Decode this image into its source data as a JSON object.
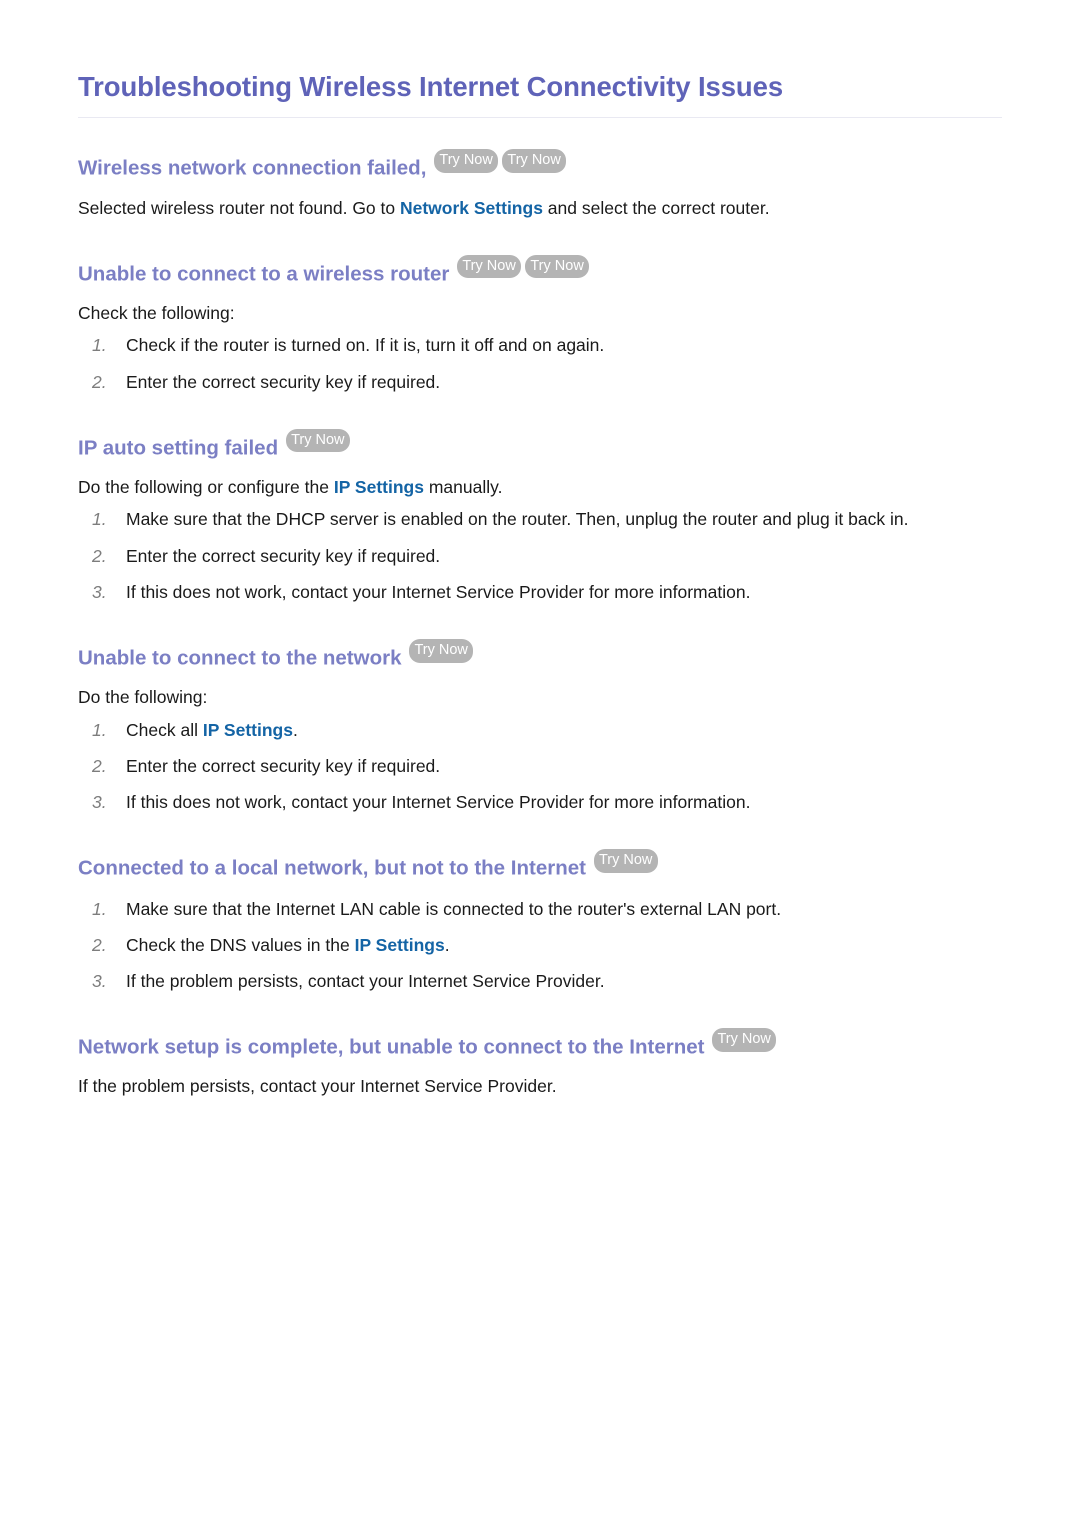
{
  "page": {
    "title": "Troubleshooting Wireless Internet Connectivity Issues"
  },
  "colors": {
    "title": "#5f63b8",
    "section_heading": "#7b7fc4",
    "link": "#1464a5",
    "badge_background": "#b4b4b4",
    "badge_text": "#ffffff",
    "body_text": "#1a1a1a",
    "list_number": "#7d7d7d",
    "page_background": "#ffffff"
  },
  "badge_label": "Try Now",
  "sections": [
    {
      "heading": "Wireless network connection failed,",
      "badges": [
        "Try Now",
        "Try Now"
      ],
      "intro": "",
      "paragraph_parts": [
        {
          "text": "Selected wireless router not found. Go to ",
          "link": false
        },
        {
          "text": "Network Settings",
          "link": true
        },
        {
          "text": " and select the correct router.",
          "link": false
        }
      ],
      "steps": []
    },
    {
      "heading": "Unable to connect to a wireless router",
      "badges": [
        "Try Now",
        "Try Now"
      ],
      "intro": "Check the following:",
      "paragraph_parts": [],
      "steps": [
        {
          "number": "1.",
          "parts": [
            {
              "text": "Check if the router is turned on. If it is, turn it off and on again.",
              "link": false
            }
          ]
        },
        {
          "number": "2.",
          "parts": [
            {
              "text": "Enter the correct security key if required.",
              "link": false
            }
          ]
        }
      ]
    },
    {
      "heading": "IP auto setting failed",
      "badges": [
        "Try Now"
      ],
      "intro": "",
      "paragraph_parts": [
        {
          "text": "Do the following or configure the ",
          "link": false
        },
        {
          "text": "IP Settings",
          "link": true
        },
        {
          "text": " manually.",
          "link": false
        }
      ],
      "steps": [
        {
          "number": "1.",
          "parts": [
            {
              "text": "Make sure that the DHCP server is enabled on the router. Then, unplug the router and plug it back in.",
              "link": false
            }
          ]
        },
        {
          "number": "2.",
          "parts": [
            {
              "text": "Enter the correct security key if required.",
              "link": false
            }
          ]
        },
        {
          "number": "3.",
          "parts": [
            {
              "text": "If this does not work, contact your Internet Service Provider for more information.",
              "link": false
            }
          ]
        }
      ]
    },
    {
      "heading": "Unable to connect to the network",
      "badges": [
        "Try Now"
      ],
      "intro": "Do the following:",
      "paragraph_parts": [],
      "steps": [
        {
          "number": "1.",
          "parts": [
            {
              "text": "Check all ",
              "link": false
            },
            {
              "text": "IP Settings",
              "link": true
            },
            {
              "text": ".",
              "link": false
            }
          ]
        },
        {
          "number": "2.",
          "parts": [
            {
              "text": "Enter the correct security key if required.",
              "link": false
            }
          ]
        },
        {
          "number": "3.",
          "parts": [
            {
              "text": "If this does not work, contact your Internet Service Provider for more information.",
              "link": false
            }
          ]
        }
      ]
    },
    {
      "heading": "Connected to a local network, but not to the Internet",
      "badges": [
        "Try Now"
      ],
      "intro": "",
      "paragraph_parts": [],
      "steps": [
        {
          "number": "1.",
          "parts": [
            {
              "text": "Make sure that the Internet LAN cable is connected to the router's external LAN port.",
              "link": false
            }
          ]
        },
        {
          "number": "2.",
          "parts": [
            {
              "text": "Check the DNS values in the ",
              "link": false
            },
            {
              "text": "IP Settings",
              "link": true
            },
            {
              "text": ".",
              "link": false
            }
          ]
        },
        {
          "number": "3.",
          "parts": [
            {
              "text": "If the problem persists, contact your Internet Service Provider.",
              "link": false
            }
          ]
        }
      ]
    },
    {
      "heading": "Network setup is complete, but unable to connect to the Internet",
      "badges": [
        "Try Now"
      ],
      "intro": "",
      "paragraph_parts": [
        {
          "text": "If the problem persists, contact your Internet Service Provider.",
          "link": false
        }
      ],
      "steps": []
    }
  ]
}
